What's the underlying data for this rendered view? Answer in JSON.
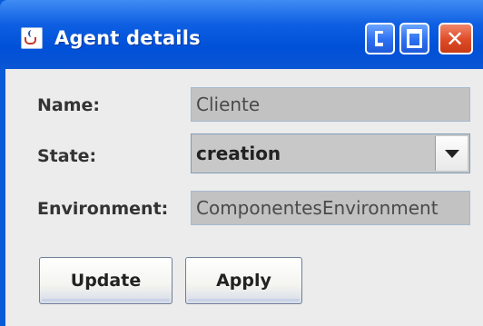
{
  "window": {
    "title": "Agent details",
    "app_icon": "java-cup-icon",
    "controls": {
      "minimize": "minimize-icon",
      "maximize": "maximize-icon",
      "close": "close-icon"
    }
  },
  "form": {
    "name_label": "Name:",
    "name_value": "Cliente",
    "state_label": "State:",
    "state_value": "creation",
    "environment_label": "Environment:",
    "environment_value": "ComponentesEnvironment"
  },
  "buttons": {
    "update": "Update",
    "apply": "Apply"
  },
  "colors": {
    "titlebar": "#0050d8",
    "panel": "#ececec",
    "field_disabled": "#c2c2c2"
  }
}
